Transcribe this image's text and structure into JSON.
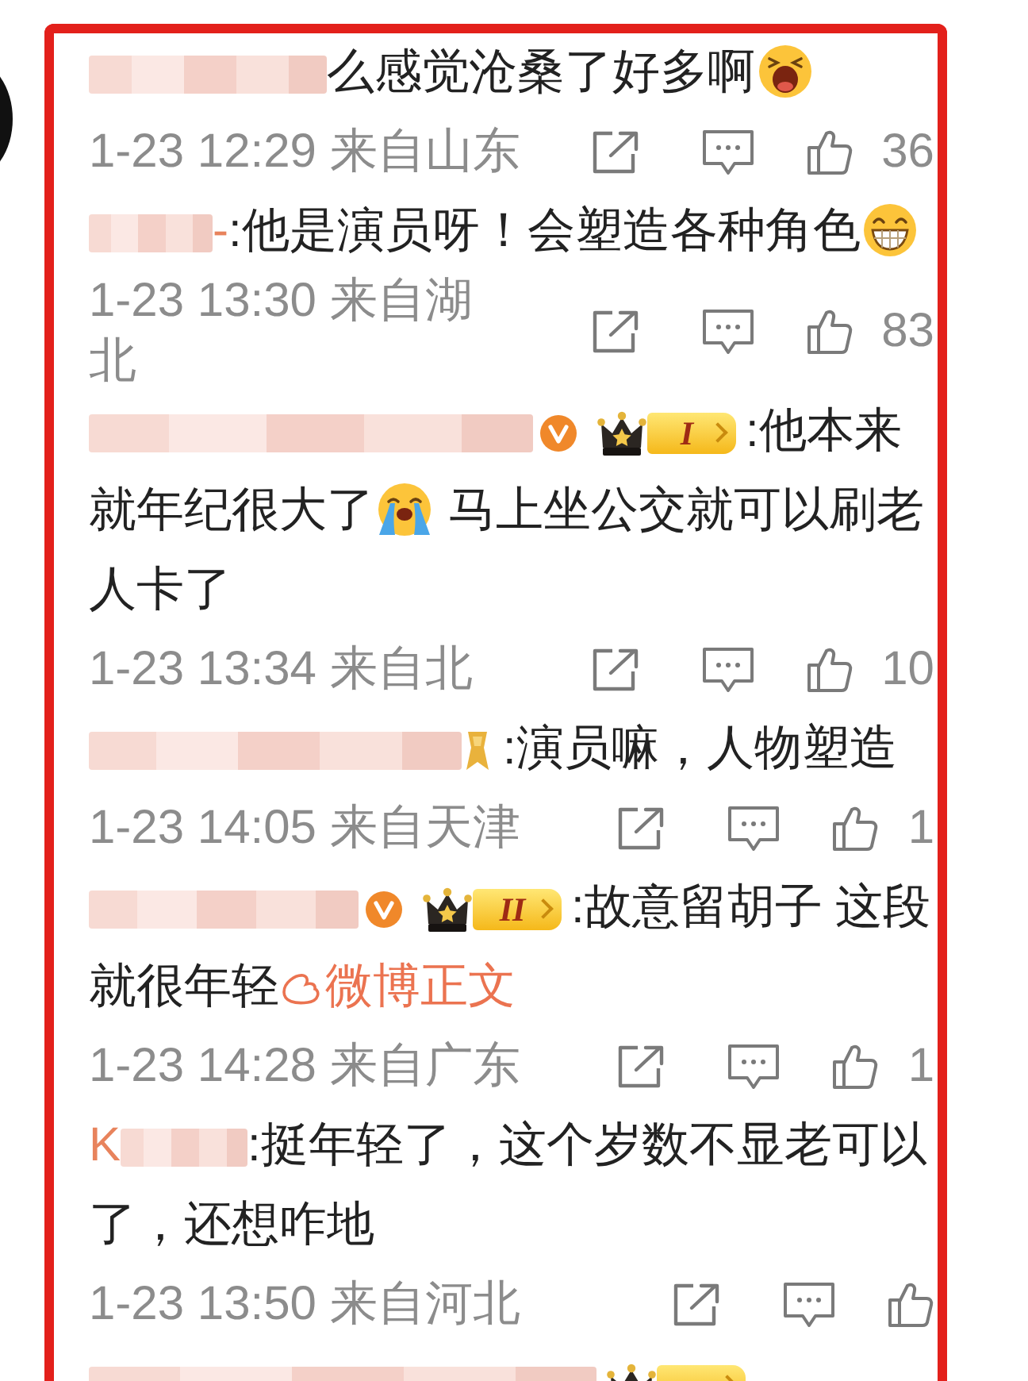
{
  "comments": [
    {
      "body": [
        {
          "kind": "text",
          "text": "么感觉沧桑了好多啊"
        },
        {
          "kind": "shocked"
        }
      ],
      "meta": "1-23 12:29 来自山东",
      "likes": "36"
    },
    {
      "name_tail": "-",
      "body": [
        {
          "kind": "text",
          "text": ":他是演员呀！会塑造各种角色"
        },
        {
          "kind": "grinning"
        }
      ],
      "meta": "1-23 13:30 来自湖北",
      "likes": "83"
    },
    {
      "badges": [
        {
          "kind": "verified"
        },
        {
          "kind": "rank",
          "text": "I"
        }
      ],
      "body": [
        {
          "kind": "text",
          "text": ":他本来就年纪很大了"
        },
        {
          "kind": "crying"
        },
        {
          "kind": "text",
          "text": " 马上坐公交就可以刷老人卡了"
        }
      ],
      "meta": "1-23 13:34 来自北",
      "likes": "10"
    },
    {
      "badges": [
        {
          "kind": "medal"
        }
      ],
      "body": [
        {
          "kind": "text",
          "text": ":演员嘛，人物塑造"
        }
      ],
      "meta": "1-23 14:05 来自天津",
      "likes": "1"
    },
    {
      "badges": [
        {
          "kind": "verified"
        },
        {
          "kind": "rank",
          "text": "II"
        }
      ],
      "body": [
        {
          "kind": "text",
          "text": ":故意留胡子 这段就很年轻"
        },
        {
          "kind": "link",
          "text": "微博正文"
        }
      ],
      "meta": "1-23 14:28 来自广东",
      "likes": "1"
    },
    {
      "name_head": "K",
      "body": [
        {
          "kind": "text",
          "text": ":挺年轻了，这个岁数不显老可以了，还想咋地"
        }
      ],
      "meta": "1-23 13:50 来自河北"
    },
    {
      "badges": [
        {
          "kind": "rank"
        }
      ]
    }
  ]
}
